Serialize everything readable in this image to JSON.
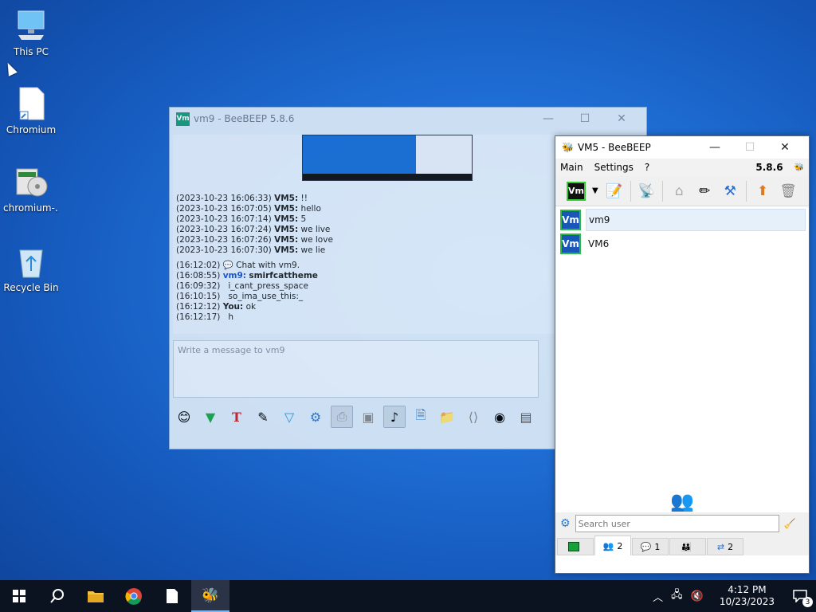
{
  "desktop": {
    "icons": [
      {
        "label": "This PC",
        "icon": "monitor-icon"
      },
      {
        "label": "Chromium",
        "icon": "file-shortcut-icon"
      },
      {
        "label": "chromium-...",
        "icon": "installer-icon"
      },
      {
        "label": "Recycle Bin",
        "icon": "recycle-bin-icon"
      }
    ]
  },
  "chat_window": {
    "title": "vm9 - BeeBEEP 5.8.6",
    "badge": "Vm",
    "messages_dated": [
      {
        "time": "(2023-10-23 16:06:33)",
        "sender": "VM5:",
        "text": "!!"
      },
      {
        "time": "(2023-10-23 16:07:05)",
        "sender": "VM5:",
        "text": "hello"
      },
      {
        "time": "(2023-10-23 16:07:14)",
        "sender": "VM5:",
        "text": "5"
      },
      {
        "time": "(2023-10-23 16:07:24)",
        "sender": "VM5:",
        "text": "we live"
      },
      {
        "time": "(2023-10-23 16:07:26)",
        "sender": "VM5:",
        "text": "we love"
      },
      {
        "time": "(2023-10-23 16:07:30)",
        "sender": "VM5:",
        "text": "we lie"
      }
    ],
    "messages_today": {
      "sys_time": "(16:12:02)",
      "sys_text": "Chat with vm9.",
      "vm9_time": "(16:08:55)",
      "vm9_sender": "vm9:",
      "vm9_text": "smirfcattheme",
      "l2_time": "(16:09:32)",
      "l2_text": "i_cant_press_space",
      "l3_time": "(16:10:15)",
      "l3_text": "so_ima_use_this:_",
      "you_time": "(16:12:12)",
      "you_sender": "You:",
      "you_text": "ok",
      "l5_time": "(16:12:17)",
      "l5_text": "h"
    },
    "input_placeholder": "Write a message to vm9"
  },
  "main_window": {
    "title": "VM5 - BeeBEEP",
    "menu": {
      "main": "Main",
      "settings": "Settings",
      "help": "?"
    },
    "version": "5.8.6",
    "status_badge": "Vm",
    "users": [
      {
        "avatar": "Vm",
        "name": "vm9"
      },
      {
        "avatar": "Vm",
        "name": "VM6"
      }
    ],
    "search_placeholder": "Search user",
    "tabs": [
      {
        "count": ""
      },
      {
        "count": "2"
      },
      {
        "count": "1"
      },
      {
        "count": ""
      },
      {
        "count": "2"
      }
    ]
  },
  "taskbar": {
    "time": "4:12 PM",
    "date": "10/23/2023",
    "notification_count": "3"
  }
}
